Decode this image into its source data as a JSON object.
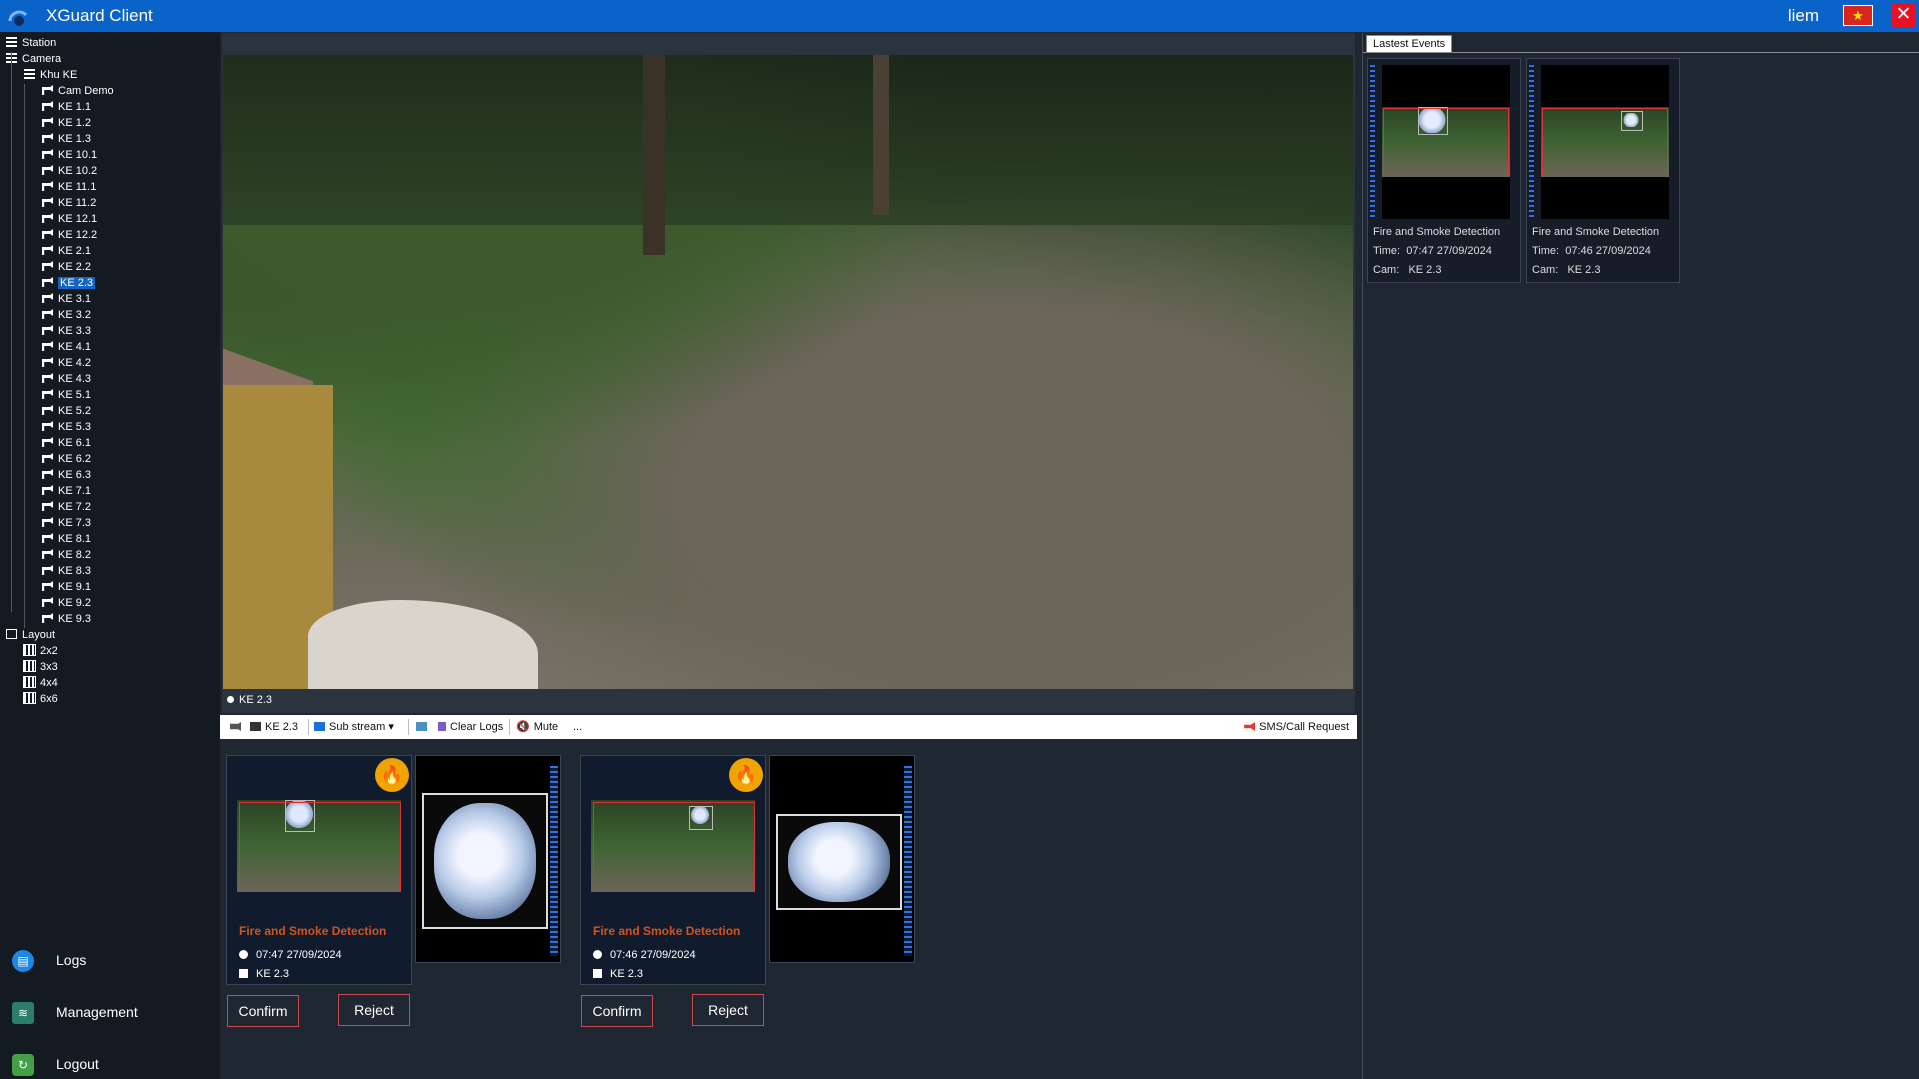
{
  "app": {
    "title": "XGuard Client",
    "user": "liem"
  },
  "tree": {
    "station": "Station",
    "camera": "Camera",
    "area": "Khu KE",
    "cameras": [
      "Cam Demo",
      "KE 1.1",
      "KE 1.2",
      "KE 1.3",
      "KE 10.1",
      "KE 10.2",
      "KE 11.1",
      "KE 11.2",
      "KE 12.1",
      "KE 12.2",
      "KE 2.1",
      "KE 2.2",
      "KE 2.3",
      "KE 3.1",
      "KE 3.2",
      "KE 3.3",
      "KE 4.1",
      "KE 4.2",
      "KE 4.3",
      "KE 5.1",
      "KE 5.2",
      "KE 5.3",
      "KE 6.1",
      "KE 6.2",
      "KE 6.3",
      "KE 7.1",
      "KE 7.2",
      "KE 7.3",
      "KE 8.1",
      "KE 8.2",
      "KE 8.3",
      "KE 9.1",
      "KE 9.2",
      "KE 9.3"
    ],
    "selected": "KE 2.3",
    "layout": "Layout",
    "layouts": [
      "2x2",
      "3x3",
      "4x4",
      "6x6"
    ]
  },
  "nav": {
    "logs": "Logs",
    "management": "Management",
    "logout": "Logout"
  },
  "video": {
    "caption": "KE 2.3"
  },
  "toolbar": {
    "camera": "KE 2.3",
    "stream": "Sub stream",
    "clear_logs": "Clear Logs",
    "mute": "Mute",
    "more": "...",
    "sms": "SMS/Call Request"
  },
  "alerts": [
    {
      "title": "Fire and Smoke Detection",
      "time": "07:47 27/09/2024",
      "cam": "KE 2.3",
      "confirm": "Confirm",
      "reject": "Reject"
    },
    {
      "title": "Fire and Smoke Detection",
      "time": "07:46 27/09/2024",
      "cam": "KE 2.3",
      "confirm": "Confirm",
      "reject": "Reject"
    }
  ],
  "latest": {
    "tab": "Lastest Events",
    "events": [
      {
        "type": "Fire and Smoke Detection",
        "time_label": "Time:",
        "time": "07:47 27/09/2024",
        "cam_label": "Cam:",
        "cam": "KE 2.3"
      },
      {
        "type": "Fire and Smoke Detection",
        "time_label": "Time:",
        "time": "07:46 27/09/2024",
        "cam_label": "Cam:",
        "cam": "KE 2.3"
      }
    ]
  },
  "colors": {
    "titlebar": "#0a63c9",
    "selection": "#1565c0",
    "alert_title": "#d2531e",
    "badge": "#f0a400",
    "button_border": "#c94a4a"
  }
}
